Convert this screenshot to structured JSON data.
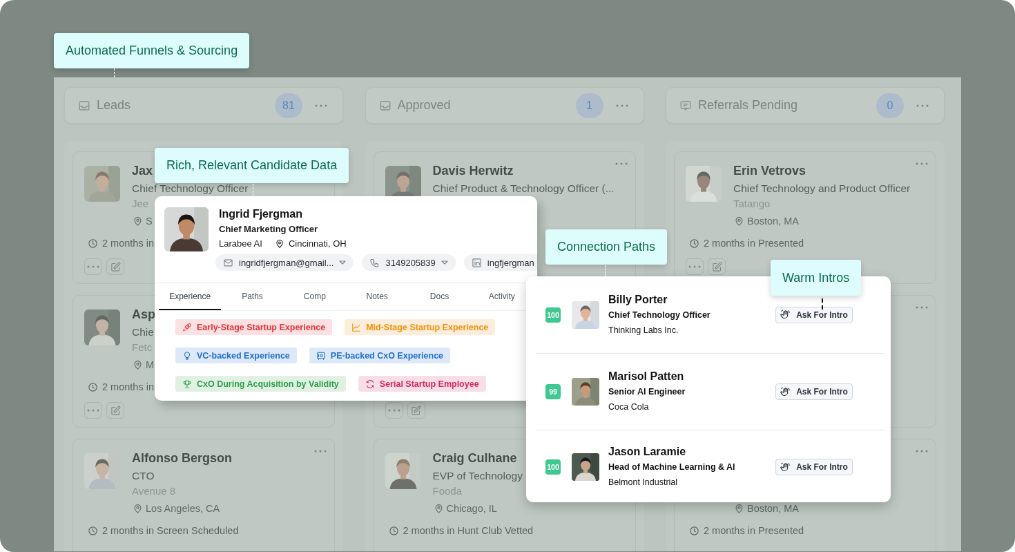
{
  "callouts": [
    {
      "label": "Automated Funnels & Sourcing"
    },
    {
      "label": "Rich, Relevant Candidate Data"
    },
    {
      "label": "Connection Paths"
    },
    {
      "label": "Warm Intros"
    }
  ],
  "board": {
    "columns": [
      {
        "title": "Leads",
        "count": "81",
        "kind": "inbox",
        "cards": [
          {
            "name": "Jax",
            "title": "Chief Technology Officer",
            "company": "Jee",
            "location": "S",
            "time": "2 months in",
            "avatar": true,
            "menu": false,
            "actions": true
          },
          {
            "name": "Asp",
            "title": "Chie",
            "company": "Fetc",
            "location": "M",
            "time": "2 months in",
            "avatar": true,
            "menu": false,
            "actions": true
          },
          {
            "name": "Alfonso Bergson",
            "title": "CTO",
            "company": "Avenue 8",
            "location": "Los Angeles, CA",
            "time": "2 months in Screen Scheduled",
            "avatar": true,
            "menu": true,
            "actions": false
          }
        ]
      },
      {
        "title": "Approved",
        "count": "1",
        "kind": "inbox",
        "cards": [
          {
            "name": "Davis Herwitz",
            "title": "Chief Product & Technology Officer (...",
            "avatar": true,
            "menu": true,
            "actions": false
          },
          {
            "avatar": false,
            "menu": false,
            "actions": true
          },
          {
            "name": "Craig Culhane",
            "title": "EVP of Technology",
            "company": "Fooda",
            "location": "Chicago, IL",
            "time": "2 months in Hunt Club Vetted",
            "avatar": true,
            "menu": false,
            "actions": false
          }
        ]
      },
      {
        "title": "Referrals Pending",
        "count": "0",
        "kind": "message",
        "cards": [
          {
            "name": "Erin Vetrovs",
            "title": "Chief Technology and Product Officer",
            "company": "Tatango",
            "location": "Boston, MA",
            "time": "2 months in Presented",
            "avatar": true,
            "menu": true,
            "actions": true
          },
          {
            "avatar": false,
            "menu": true,
            "actions": false
          },
          {
            "location": "Boston, MA",
            "time": "2 months in Presented",
            "avatar": false,
            "menu": true,
            "actions": false
          }
        ]
      }
    ]
  },
  "profile": {
    "name": "Ingrid Fjergman",
    "title": "Chief Marketing Officer",
    "company": "Larabee AI",
    "location": "Cincinnati, OH",
    "contacts": [
      {
        "kind": "email",
        "value": "ingridfjergman@gmail...",
        "dropdown": true
      },
      {
        "kind": "phone",
        "value": "3149205839",
        "dropdown": true
      },
      {
        "kind": "linkedin",
        "value": "ingfjergman",
        "dropdown": false
      }
    ],
    "tabs": [
      {
        "label": "Experience",
        "selected": true
      },
      {
        "label": "Paths",
        "selected": false
      },
      {
        "label": "Comp",
        "selected": false
      },
      {
        "label": "Notes",
        "selected": false
      },
      {
        "label": "Docs",
        "selected": false
      },
      {
        "label": "Activity",
        "selected": false
      }
    ],
    "tags": [
      {
        "label": "Early-Stage Startup Experience",
        "kind": "rocket",
        "color": "#e1353b"
      },
      {
        "label": "Mid-Stage Startup Experience",
        "kind": "chart",
        "color": "#ef900c"
      },
      {
        "label": "VC-backed Experience",
        "kind": "bulb",
        "color": "#1f6fcf"
      },
      {
        "label": "PE-backed CxO Experience",
        "kind": "safe",
        "color": "#1f6fcf"
      },
      {
        "label": "CxO During Acquisition by Validity",
        "kind": "trophy",
        "color": "#2e9f47"
      },
      {
        "label": "Serial Startup Employee",
        "kind": "refresh",
        "color": "#d3285f"
      }
    ]
  },
  "paths": {
    "rows": [
      {
        "score": "100",
        "name": "Billy Porter",
        "title": "Chief Technology Officer",
        "company": "Thinking Labs Inc.",
        "action": "Ask For Intro"
      },
      {
        "score": "99",
        "name": "Marisol Patten",
        "title": "Senior AI Engineer",
        "company": "Coca Cola",
        "action": "Ask For Intro"
      },
      {
        "score": "100",
        "name": "Jason Laramie",
        "title": "Head of Machine Learning & AI",
        "company": "Belmont Industrial",
        "action": "Ask For Intro"
      }
    ]
  }
}
